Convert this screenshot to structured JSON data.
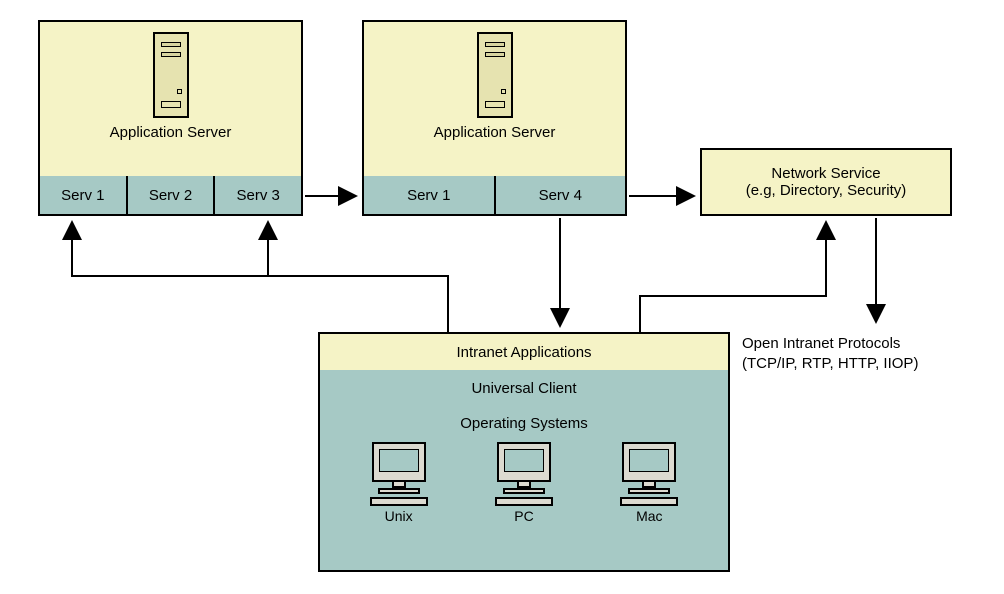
{
  "app_server_1": {
    "title": "Application Server",
    "services": [
      "Serv 1",
      "Serv 2",
      "Serv 3"
    ]
  },
  "app_server_2": {
    "title": "Application Server",
    "services": [
      "Serv 1",
      "Serv 4"
    ]
  },
  "network_service": {
    "line1": "Network Service",
    "line2": "(e.g, Directory, Security)"
  },
  "client_stack": {
    "intranet_apps": "Intranet Applications",
    "universal_client": "Universal Client",
    "operating_systems": "Operating Systems",
    "os_list": [
      "Unix",
      "PC",
      "Mac"
    ]
  },
  "protocols": {
    "line1": "Open Intranet Protocols",
    "line2": "(TCP/IP, RTP, HTTP, IIOP)"
  }
}
